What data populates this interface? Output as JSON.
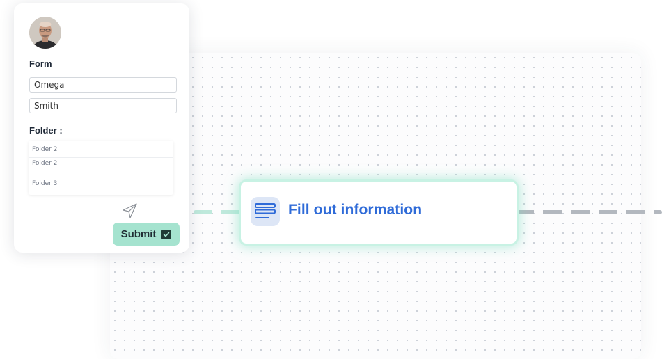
{
  "form": {
    "title": "Form",
    "first_name": "Omega",
    "last_name": "Smith",
    "folder_label": "Folder :",
    "folders": [
      "Folder 2",
      "Folder 2",
      "Folder 3"
    ],
    "submit_label": "Submit"
  },
  "workflow": {
    "step_title": "Fill out information",
    "step_icon": "form-lines-icon"
  },
  "icons": {
    "send": "paper-plane-icon",
    "checkbox": "checkbox-checked-icon"
  },
  "colors": {
    "accent_blue": "#2f6bd8",
    "accent_mint": "#a5e3cf",
    "glow_mint": "#c8f2e4",
    "dash_gray": "#b3b8bf"
  }
}
